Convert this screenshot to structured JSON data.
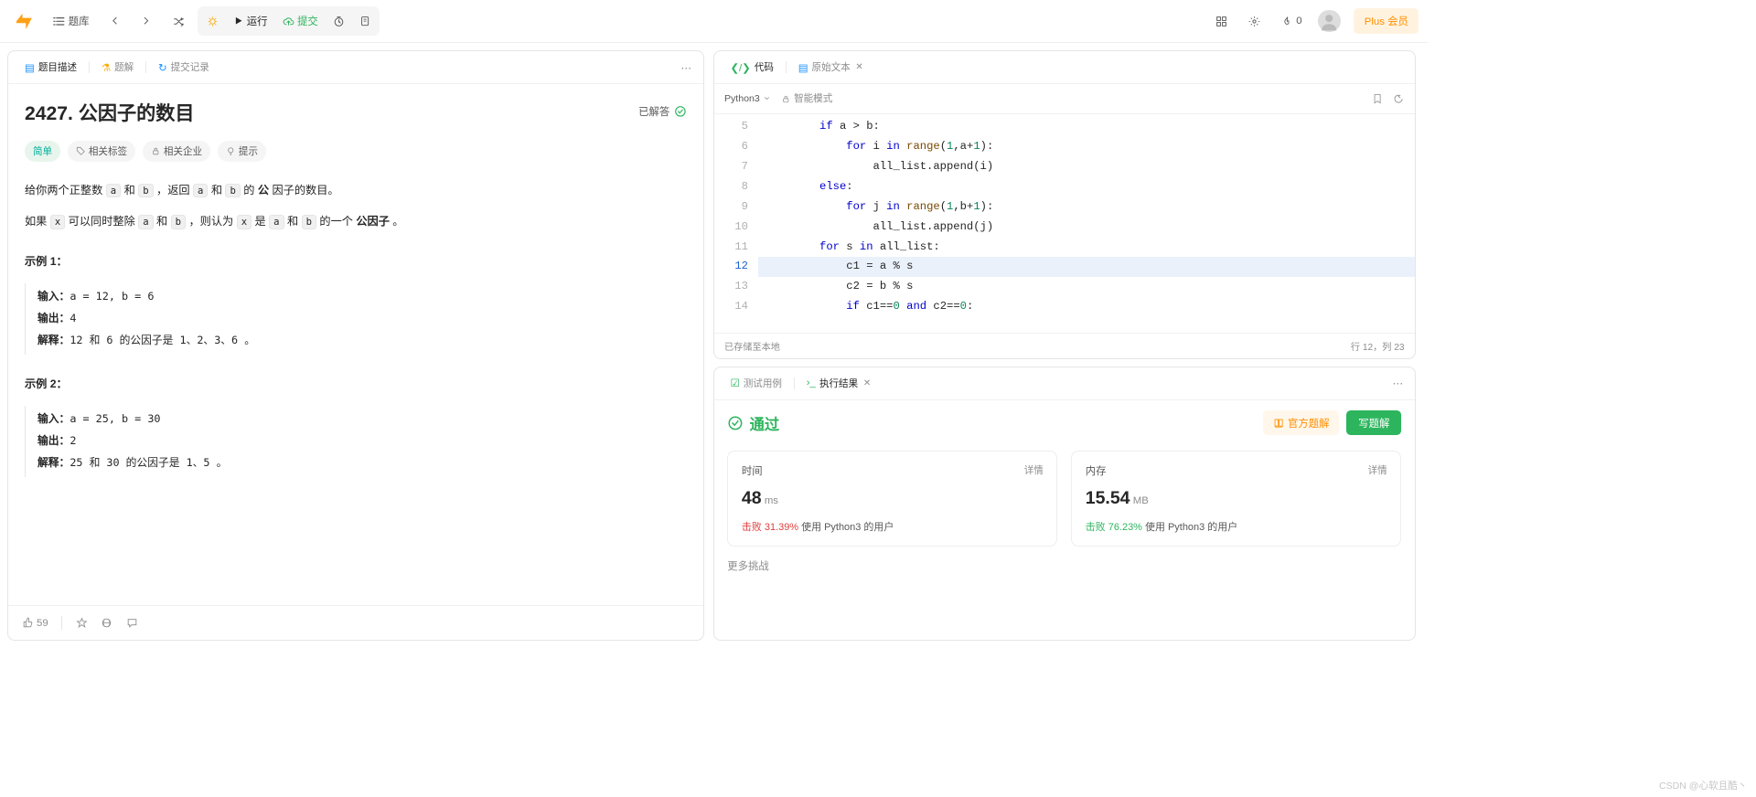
{
  "topbar": {
    "problems": "题库",
    "run": "运行",
    "submit": "提交",
    "streak": "0",
    "plus": "Plus 会员"
  },
  "leftTabs": {
    "desc": "题目描述",
    "sol": "题解",
    "subs": "提交记录"
  },
  "problem": {
    "title": "2427. 公因子的数目",
    "solved": "已解答",
    "difficulty": "简单",
    "tags": "相关标签",
    "companies": "相关企业",
    "hint": "提示",
    "p1a": "给你两个正整数 ",
    "p1b": " 和 ",
    "p1c": " ，返回 ",
    "p1d": " 和 ",
    "p1e": " 的 ",
    "p1bold": "公",
    "p1f": " 因子的数目。",
    "p2a": "如果 ",
    "p2b": " 可以同时整除 ",
    "p2c": " 和 ",
    "p2d": " ，则认为 ",
    "p2e": " 是 ",
    "p2f": " 和 ",
    "p2g": " 的一个 ",
    "p2bold": "公因子",
    "p2h": " 。",
    "var_a": "a",
    "var_b": "b",
    "var_x": "x",
    "ex1_title": "示例 1：",
    "ex2_title": "示例 2：",
    "labels": {
      "input": "输入：",
      "output": "输出：",
      "explain": "解释："
    },
    "ex1": {
      "input": "a = 12, b = 6",
      "output": "4",
      "explain": "12 和 6 的公因子是 1、2、3、6 。"
    },
    "ex2": {
      "input": "a = 25, b = 30",
      "output": "2",
      "explain": "25 和 30 的公因子是 1、5 。"
    },
    "likes": "59"
  },
  "codeTabs": {
    "code": "代码",
    "raw": "原始文本"
  },
  "editor": {
    "lang": "Python3",
    "mode": "智能模式",
    "status": "已存储至本地",
    "pos": "行 12，列 23",
    "lineStart": 5,
    "highlightLine": 12,
    "lines": [
      {
        "indent": 8,
        "tokens": [
          {
            "t": "if ",
            "c": "kw"
          },
          {
            "t": "a > b:"
          }
        ]
      },
      {
        "indent": 12,
        "tokens": [
          {
            "t": "for ",
            "c": "kw"
          },
          {
            "t": "i "
          },
          {
            "t": "in ",
            "c": "kw"
          },
          {
            "t": "range",
            "c": "fn"
          },
          {
            "t": "("
          },
          {
            "t": "1",
            "c": "num"
          },
          {
            "t": ",a+"
          },
          {
            "t": "1",
            "c": "num"
          },
          {
            "t": "):"
          }
        ]
      },
      {
        "indent": 16,
        "tokens": [
          {
            "t": "all_list.append(i)"
          }
        ]
      },
      {
        "indent": 8,
        "tokens": [
          {
            "t": "else",
            "c": "kw"
          },
          {
            "t": ":"
          }
        ]
      },
      {
        "indent": 12,
        "tokens": [
          {
            "t": "for ",
            "c": "kw"
          },
          {
            "t": "j "
          },
          {
            "t": "in ",
            "c": "kw"
          },
          {
            "t": "range",
            "c": "fn"
          },
          {
            "t": "("
          },
          {
            "t": "1",
            "c": "num"
          },
          {
            "t": ",b+"
          },
          {
            "t": "1",
            "c": "num"
          },
          {
            "t": "):"
          }
        ]
      },
      {
        "indent": 16,
        "tokens": [
          {
            "t": "all_list.append(j)"
          }
        ]
      },
      {
        "indent": 8,
        "tokens": [
          {
            "t": "for ",
            "c": "kw"
          },
          {
            "t": "s "
          },
          {
            "t": "in ",
            "c": "kw"
          },
          {
            "t": "all_list:"
          }
        ]
      },
      {
        "indent": 12,
        "tokens": [
          {
            "t": "c1 = a % s"
          }
        ]
      },
      {
        "indent": 12,
        "tokens": [
          {
            "t": "c2 = b % s"
          }
        ]
      },
      {
        "indent": 12,
        "tokens": [
          {
            "t": "if ",
            "c": "kw"
          },
          {
            "t": "c1=="
          },
          {
            "t": "0",
            "c": "num"
          },
          {
            "t": " and ",
            "c": "kw"
          },
          {
            "t": "c2=="
          },
          {
            "t": "0",
            "c": "num"
          },
          {
            "t": ":"
          }
        ]
      }
    ]
  },
  "resTabs": {
    "tests": "测试用例",
    "result": "执行结果"
  },
  "result": {
    "pass": "通过",
    "official": "官方题解",
    "write": "写题解",
    "time_label": "时间",
    "mem_label": "内存",
    "detail": "详情",
    "time_val": "48",
    "time_unit": "ms",
    "mem_val": "15.54",
    "mem_unit": "MB",
    "beat": "击败",
    "time_pct": "31.39%",
    "mem_pct": "76.23%",
    "suffix": "使用 Python3 的用户",
    "more": "更多挑战"
  },
  "watermark": "CSDN @心软且酷丶"
}
